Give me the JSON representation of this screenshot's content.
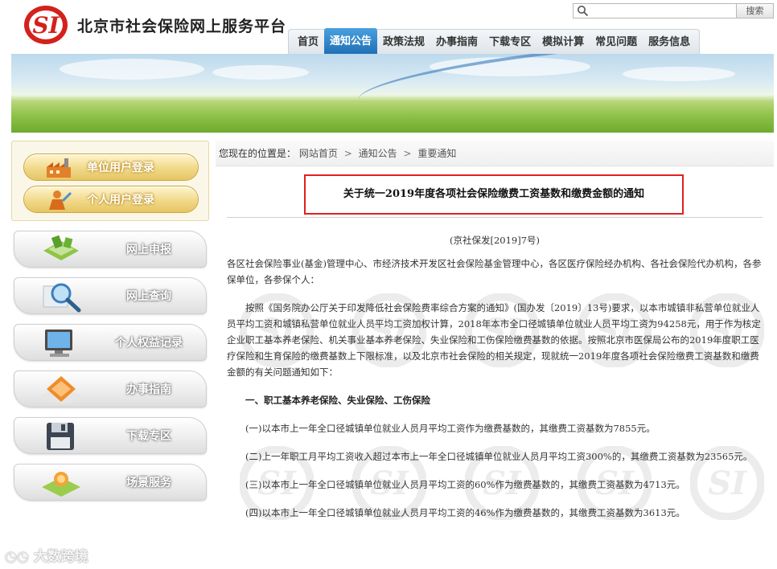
{
  "site": {
    "title": "北京市社会保险网上服务平台",
    "logo_icon": "si-logo-icon",
    "brand_color": "#d4211b"
  },
  "search": {
    "value": "",
    "placeholder": "",
    "button_label": "搜索"
  },
  "nav": {
    "items": [
      {
        "label": "首页",
        "active": false
      },
      {
        "label": "通知公告",
        "active": true
      },
      {
        "label": "政策法规",
        "active": false
      },
      {
        "label": "办事指南",
        "active": false
      },
      {
        "label": "下载专区",
        "active": false
      },
      {
        "label": "模拟计算",
        "active": false
      },
      {
        "label": "常见问题",
        "active": false
      },
      {
        "label": "服务信息",
        "active": false
      }
    ],
    "active_color": "#2c86cc"
  },
  "sidebar": {
    "login": [
      {
        "label": "单位用户登录",
        "icon": "factory-icon"
      },
      {
        "label": "个人用户登录",
        "icon": "person-icon"
      }
    ],
    "items": [
      {
        "label": "网上申报",
        "icon": "declare-icon"
      },
      {
        "label": "网上查询",
        "icon": "magnifier-icon"
      },
      {
        "label": "个人权益记录",
        "icon": "computer-icon"
      },
      {
        "label": "办事指南",
        "icon": "guide-icon"
      },
      {
        "label": "下载专区",
        "icon": "floppy-disk-icon"
      },
      {
        "label": "场景服务",
        "icon": "scene-icon"
      }
    ]
  },
  "breadcrumb": {
    "prefix": "您现在的位置是：",
    "items": [
      "网站首页",
      "通知公告",
      "重要通知"
    ],
    "separator": ">"
  },
  "article": {
    "title": "关于统一2019年度各项社会保险缴费工资基数和缴费金额的通知",
    "doc_number": "(京社保发[2019]7号)",
    "addressee": "各区社会保险事业(基金)管理中心、市经济技术开发区社会保险基金管理中心，各区医疗保险经办机构、各社会保险代办机构，各参保单位，各参保个人：",
    "intro": "按照《国务院办公厅关于印发降低社会保险费率综合方案的通知》(国办发〔2019〕13号)要求，以本市城镇非私营单位就业人员平均工资和城镇私营单位就业人员平均工资加权计算，2018年本市全口径城镇单位就业人员平均工资为94258元，用于作为核定企业职工基本养老保险、机关事业基本养老保险、失业保险和工伤保险缴费基数的依据。按照北京市医保局公布的2019年度职工医疗保险和生育保险的缴费基数上下限标准，以及北京市社会保险的相关规定，现就统一2019年度各项社会保险缴费工资基数和缴费金额的有关问题通知如下：",
    "section1_heading": "一、职工基本养老保险、失业保险、工伤保险",
    "items": [
      "(一)以本市上一年全口径城镇单位就业人员月平均工资作为缴费基数的，其缴费工资基数为7855元。",
      "(二)上一年职工月平均工资收入超过本市上一年全口径城镇单位就业人员月平均工资300%的，其缴费工资基数为23565元。",
      "(三)以本市上一年全口径城镇单位就业人员月平均工资的60%作为缴费基数的，其缴费工资基数为4713元。",
      "(四)以本市上一年全口径城镇单位就业人员月平均工资的46%作为缴费基数的，其缴费工资基数为3613元。"
    ],
    "highlight_color": "#e02020"
  },
  "watermark": {
    "corner_text": "大数跨境"
  }
}
